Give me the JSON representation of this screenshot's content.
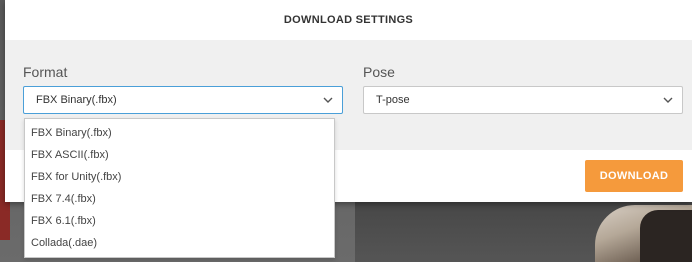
{
  "modal": {
    "title": "DOWNLOAD SETTINGS",
    "format": {
      "label": "Format",
      "selected": "FBX Binary(.fbx)",
      "options": [
        "FBX Binary(.fbx)",
        "FBX ASCII(.fbx)",
        "FBX for Unity(.fbx)",
        "FBX 7.4(.fbx)",
        "FBX 6.1(.fbx)",
        "Collada(.dae)"
      ]
    },
    "pose": {
      "label": "Pose",
      "selected": "T-pose"
    },
    "download_label": "DOWNLOAD"
  },
  "colors": {
    "accent": "#f59a3c",
    "focus_border": "#4a9fd8"
  },
  "icons": {
    "format_chevron": "chevron-down-icon",
    "pose_chevron": "chevron-down-icon"
  }
}
